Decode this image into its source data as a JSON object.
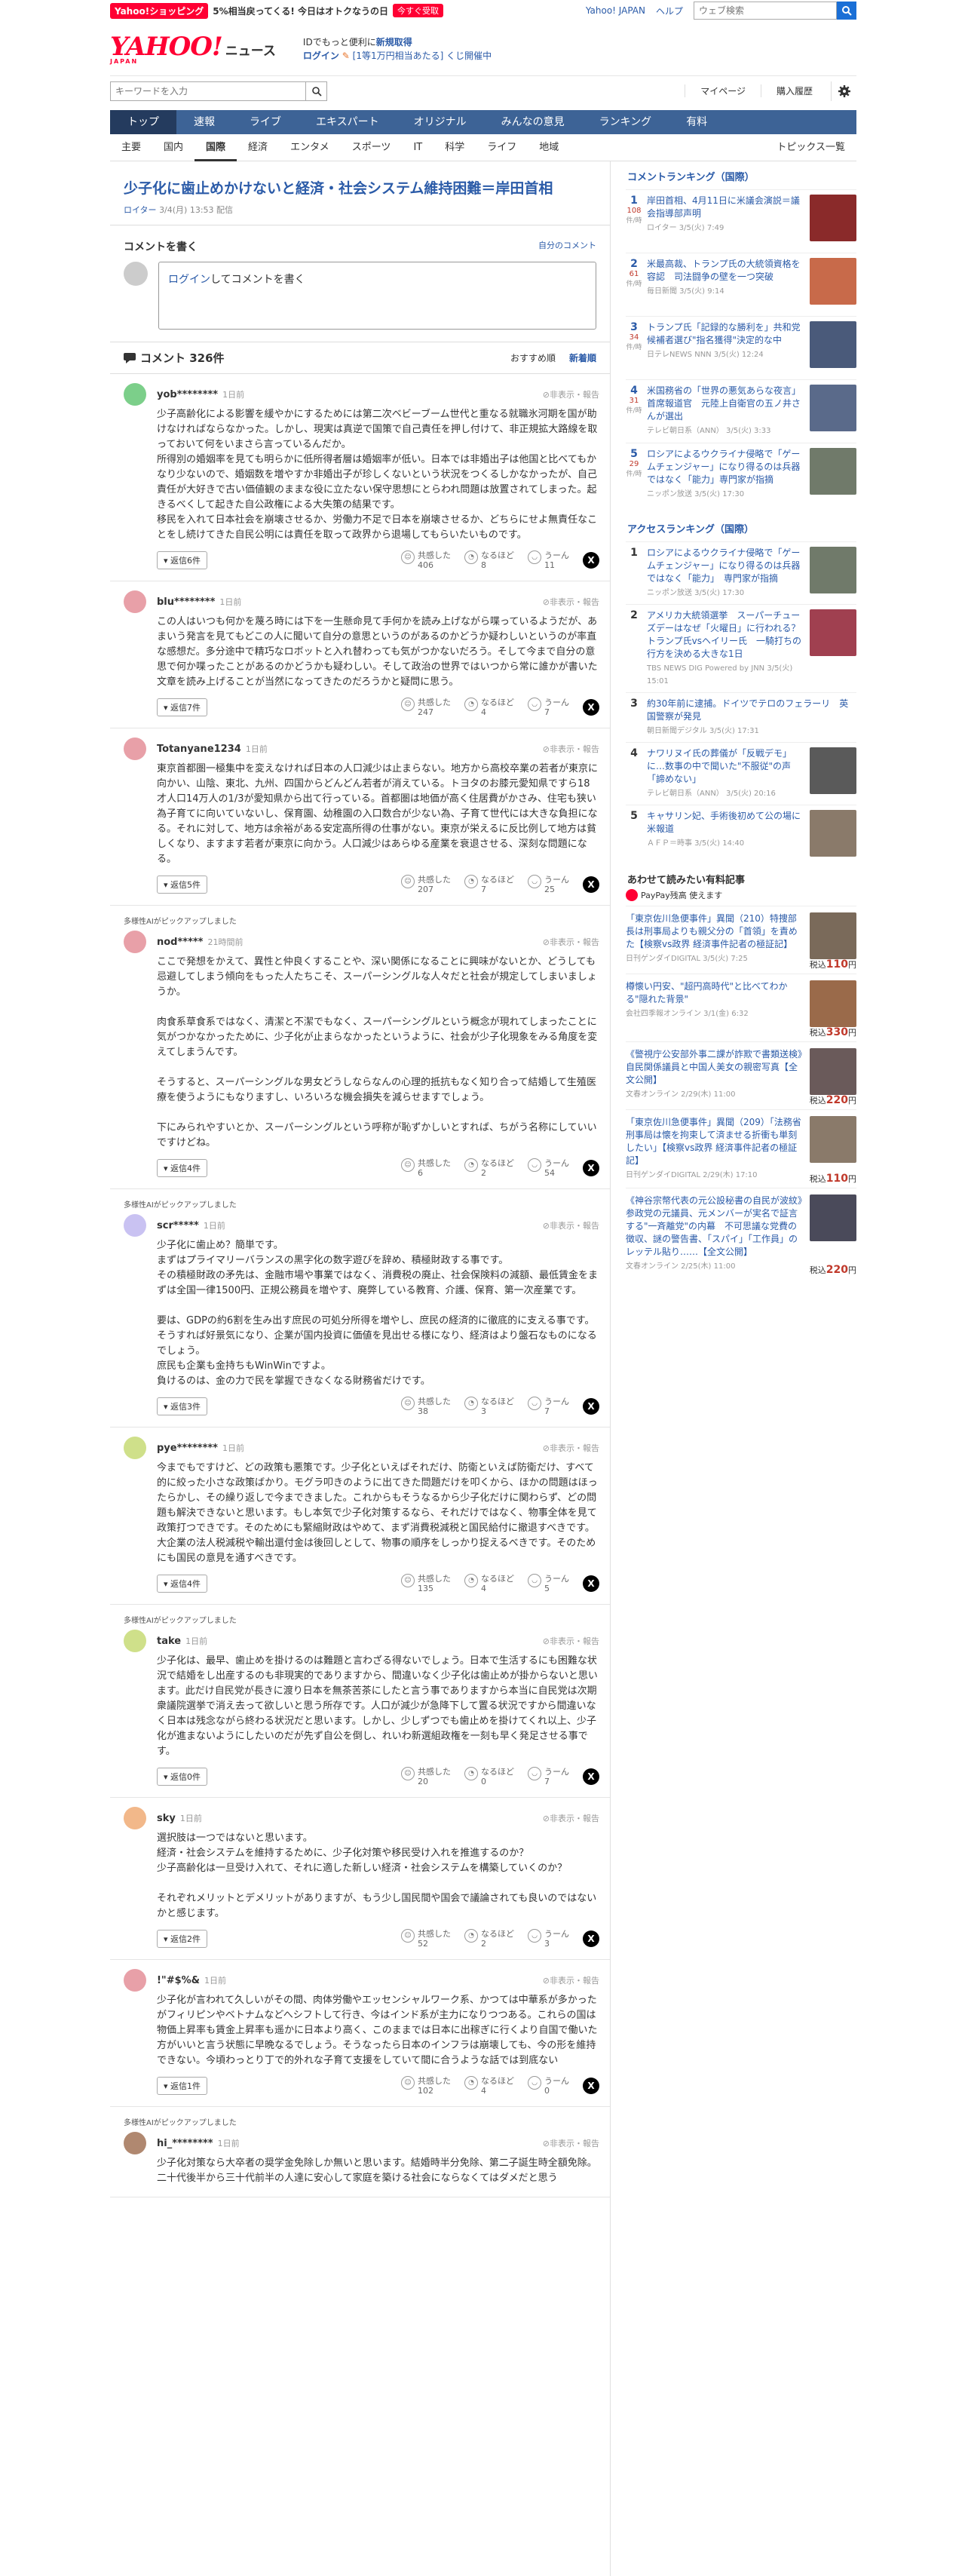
{
  "promo": {
    "shop": "Yahoo!ショッピング",
    "text": "5%相当戻ってくる! 今日はオトクなうの日",
    "button": "今すぐ受取"
  },
  "top_links": {
    "yahoo_japan": "Yahoo! JAPAN",
    "help": "ヘルプ",
    "search_placeholder": "ウェブ検索"
  },
  "logo": {
    "brand": "YAHOO!",
    "sub": "JAPAN",
    "news": "ニュース"
  },
  "header_msgs": {
    "line1_pre": "IDでもっと便利に",
    "line1_link": "新規取得",
    "line2_link": "ログイン",
    "line2_post": "[1等1万円相当あたる] くじ開催中"
  },
  "search": {
    "placeholder": "キーワードを入力"
  },
  "right_links": [
    "マイページ",
    "購入履歴"
  ],
  "main_nav": [
    {
      "label": "トップ",
      "active": true
    },
    {
      "label": "速報"
    },
    {
      "label": "ライブ"
    },
    {
      "label": "エキスパート"
    },
    {
      "label": "オリジナル"
    },
    {
      "label": "みんなの意見"
    },
    {
      "label": "ランキング"
    },
    {
      "label": "有料"
    }
  ],
  "sub_nav": [
    {
      "label": "主要"
    },
    {
      "label": "国内"
    },
    {
      "label": "国際",
      "active": true
    },
    {
      "label": "経済"
    },
    {
      "label": "エンタメ"
    },
    {
      "label": "スポーツ"
    },
    {
      "label": "IT"
    },
    {
      "label": "科学"
    },
    {
      "label": "ライフ"
    },
    {
      "label": "地域"
    }
  ],
  "topics": "トピックス一覧",
  "article": {
    "title": "少子化に歯止めかけないと経済・社会システム維持困難＝岸田首相",
    "source": "ロイター",
    "date": "3/4(月) 13:53 配信"
  },
  "comment_write": {
    "heading": "コメントを書く",
    "link": "自分のコメント",
    "login": "ログイン",
    "prompt": "してコメントを書く"
  },
  "comment_list": {
    "count": "コメント 326件",
    "sort_recommended": "おすすめ順",
    "sort_newest": "新着順"
  },
  "report_label": "非表示・報告",
  "react_labels": {
    "empathy": "共感した",
    "naruhodo": "なるほど",
    "uun": "うーん"
  },
  "comments": [
    {
      "user": "yob********",
      "time": "1日前",
      "color": "#7ccf8a",
      "pickup": "",
      "body": "少子高齢化による影響を緩やかにするためには第二次ベビーブーム世代と重なる就職氷河期を国が助けなければならなかった。しかし、現実は真逆で国策で自己責任を押し付けて、非正規拡大路線を取っておいて何をいまさら言っているんだか。\n所得別の婚姻率を見ても明らかに低所得者層は婚姻率が低い。日本では非婚出子は他国と比べてもかなり少ないので、婚姻数を増やすか非婚出子が珍しくないという状況をつくるしかなかったが、自己責任が大好きで古い価値観のままな役に立たない保守思想にとらわれ問題は放置されてしまった。起きるべくして起きた自公政権による大失策の結果です。\n移民を入れて日本社会を崩壊させるか、労働力不足で日本を崩壊させるか、どちらにせよ無責任なことをし続けてきた自民公明には責任を取って政界から退場してもらいたいものです。",
      "replies": "返信6件",
      "empathy": 406,
      "naruhodo": 8,
      "uun": 11
    },
    {
      "user": "blu********",
      "time": "1日前",
      "color": "#e8a0a8",
      "pickup": "",
      "body": "この人はいつも何かを蔑ろ時には下を一生懸命見て手何かを読み上げながら喋っているようだが、あまいう発言を見てもどこの人に聞いて自分の意思というのがあるのかどうか疑わしいというのが率直な感想だ。多分途中で精巧なロボットと入れ替わっても気がつかないだろう。そして今まで自分の意思で何か喋ったことがあるのかどうかも疑わしい。そして政治の世界ではいつから常に誰かが書いた文章を読み上げることが当然になってきたのだろうかと疑問に思う。",
      "replies": "返信7件",
      "empathy": 247,
      "naruhodo": 4,
      "uun": 7
    },
    {
      "user": "Totanyane1234",
      "time": "1日前",
      "color": "#e8a0a8",
      "pickup": "",
      "body": "東京首都圏一極集中を変えなければ日本の人口減少は止まらない。地方から高校卒業の若者が東京に向かい、山陰、東北、九州、四国からどんどん若者が消えている。トヨタのお膝元愛知県ですら18才人口14万人の1/3が愛知県から出て行っている。首都圏は地価が高く住居費がかさみ、住宅も狭い為子育てに向いていないし、保育園、幼稚園の入口数合が少ない為、子育て世代には大きな負担になる。それに対して、地方は余裕がある安定高所得の仕事がない。東京が栄えるに反比例して地方は貧しくなり、ますます若者が東京に向かう。人口減少はあらゆる産業を衰退させる、深刻な問題になる。",
      "replies": "返信5件",
      "empathy": 207,
      "naruhodo": 7,
      "uun": 25
    },
    {
      "user": "nod*****",
      "time": "21時間前",
      "color": "#e8a0a8",
      "pickup": "多様性AIがピックアップしました",
      "body": "ここで発想をかえて、異性と仲良くすることや、深い関係になることに興味がないとか、どうしても忌避してしまう傾向をもった人たちこそ、スーパーシングルな人々だと社会が規定してしまいましょうか。\n\n肉食系草食系ではなく、清潔と不潔でもなく、スーパーシングルという概念が現れてしまったことに気がつかなかったために、少子化が止まらなかったというように、社会が少子化現象をみる角度を変えてしまうんです。\n\nそうすると、スーパーシングルな男女どうしならなんの心理的抵抗もなく知り合って結婚して生殖医療を使うようにもなりますし、いろいろな機会損失を減らせますでしょう。\n\n下にみられやすいとか、スーパーシングルという呼称が恥ずかしいとすれば、ちがう名称にしていいですけどね。",
      "replies": "返信4件",
      "empathy": 6,
      "naruhodo": 2,
      "uun": 54
    },
    {
      "user": "scr*****",
      "time": "1日前",
      "color": "#c9c2f2",
      "pickup": "多様性AIがピックアップしました",
      "body": "少子化に歯止め？簡単です。\nまずはプライマリーバランスの黒字化の数字遊びを辞め、積極財政する事です。\nその積極財政の矛先は、金融市場や事業ではなく、消費税の廃止、社会保険料の減額、最低賃金をまずは全国一律1500円、正規公務員を増やす、廃弊している教育、介護、保育、第一次産業です。\n\n要は、GDPの約6割を生み出す庶民の可処分所得を増やし、庶民の経済的に徹底的に支える事です。\nそうすれば好景気になり、企業が国内投資に価値を見出せる様になり、経済はより盤石なものになるでしょう。\n庶民も企業も金持ちもWinWinですよ。\n負けるのは、金の力で民を掌握できなくなる財務省だけです。",
      "replies": "返信3件",
      "empathy": 38,
      "naruhodo": 3,
      "uun": 7
    },
    {
      "user": "pye********",
      "time": "1日前",
      "color": "#cfe08a",
      "pickup": "",
      "body": "今までもですけど、どの政策も悪策です。少子化といえばそれだけ、防衛といえば防衛だけ、すべて的に絞った小さな政策ばかり。モグラ叩きのように出てきた問題だけを叩くから、ほかの問題はほったらかし、その繰り返しで今まできました。これからもそうなるから少子化だけに関わらず、どの問題も解決できないと思います。もし本気で少子化対策するなら、それだけではなく、物事全体を見て政策打つできです。そのためにも緊縮財政はやめて、まず消費税減税と国民給付に撤退すべきです。大企業の法人税減税や輸出還付金は後回しとして、物事の順序をしっかり捉えるべきです。そのためにも国民の意見を通すべきです。",
      "replies": "返信4件",
      "empathy": 135,
      "naruhodo": 4,
      "uun": 5
    },
    {
      "user": "take",
      "time": "1日前",
      "color": "#cfe08a",
      "pickup": "多様性AIがピックアップしました",
      "body": "少子化は、最早、歯止めを掛けるのは難題と言わざる得ないでしょう。日本で生活するにも困難な状況で結婚をし出産するのも非現実的でありますから、間違いなく少子化は歯止めが掛からないと思います。此だけ自民党が長きに渡り日本を無茶苦茶にしたと言う事でありますから本当に自民党は次期衆議院選挙で消え去って欲しいと思う所存です。人口が減少が急降下して置る状況ですから間違いなく日本は残念ながら終わる状況だと思います。しかし、少しずつでも歯止めを掛けてくれ以上、少子化が進まないようにしたいのだが先ず自公を倒し、れいわ新選組政権を一刻も早く発足させる事です。",
      "replies": "返信0件",
      "empathy": 20,
      "naruhodo": 0,
      "uun": 7
    },
    {
      "user": "sky",
      "time": "1日前",
      "color": "#f2b88a",
      "pickup": "",
      "body": "選択肢は一つではないと思います。\n経済・社会システムを維持するために、少子化対策や移民受け入れを推進するのか？\n少子高齢化は一旦受け入れて、それに適した新しい経済・社会システムを構築していくのか？\n\nそれぞれメリットとデメリットがありますが、もう少し国民間や国会で議論されても良いのではないかと感じます。",
      "replies": "返信2件",
      "empathy": 52,
      "naruhodo": 2,
      "uun": 3
    },
    {
      "user": "!\"#$%&",
      "time": "1日前",
      "color": "#e8a0a8",
      "pickup": "",
      "body": "少子化が言われて久しいがその間、肉体労働やエッセンシャルワーク系、かつては中華系が多かったがフィリピンやベトナムなどへシフトして行き、今はインド系が主力になりつつある。これらの国は物価上昇率も賃金上昇率も遥かに日本より高く、このままでは日本に出稼ぎに行くより自国で働いた方がいいと言う状態に早晩なるでしょう。そうなったら日本のインフラは崩壊しても、今の形を維持できない。今頃わっとり丁で的外れな子育て支援をしていて間に合うような話では到底ない",
      "replies": "返信1件",
      "empathy": 102,
      "naruhodo": 4,
      "uun": 0
    },
    {
      "user": "hi_********",
      "time": "1日前",
      "color": "#b08870",
      "pickup": "多様性AIがピックアップしました",
      "body": "少子化対策なら大卒者の奨学金免除しか無いと思います。結婚時半分免除、第二子誕生時全額免除。二十代後半から三十代前半の人達に安心して家庭を築ける社会にならなくてはダメだと思う",
      "replies": "",
      "empathy": null,
      "naruhodo": null,
      "uun": null
    }
  ],
  "side": {
    "comment_ranking_title": "コメントランキング（国際）",
    "comment_ranking": [
      {
        "rank": "1",
        "count": "108",
        "unit": "件/時",
        "title": "岸田首相、4月11日に米議会演説＝議会指導部声明",
        "src": "ロイター 3/5(火) 7:49",
        "thumb": "#8a2a2a"
      },
      {
        "rank": "2",
        "count": "61",
        "unit": "件/時",
        "title": "米最高裁、トランプ氏の大統領資格を容認　司法闘争の壁を一つ突破",
        "src": "毎日新聞 3/5(火) 9:14",
        "thumb": "#c86a4a"
      },
      {
        "rank": "3",
        "count": "34",
        "unit": "件/時",
        "title": "トランプ氏「記録的な勝利を」共和党候補者選び\"指名獲得\"決定的な中",
        "src": "日テレNEWS NNN 3/5(火) 12:24",
        "thumb": "#4a5a7a"
      },
      {
        "rank": "4",
        "count": "31",
        "unit": "件/時",
        "title": "米国務省の「世界の悪気あらな夜言」首席報道官　元陸上自衛官の五ノ井さんが選出",
        "src": "テレビ朝日系（ANN） 3/5(火) 3:33",
        "thumb": "#5a6a8a"
      },
      {
        "rank": "5",
        "count": "29",
        "unit": "件/時",
        "title": "ロシアによるウクライナ侵略で「ゲームチェンジャー」になり得るのは兵器ではなく「能力」専門家が指摘",
        "src": "ニッポン放送 3/5(火) 17:30",
        "thumb": "#707a6a"
      }
    ],
    "access_ranking_title": "アクセスランキング（国際）",
    "access_ranking": [
      {
        "rank": "1",
        "title": "ロシアによるウクライナ侵略で「ゲームチェンジャー」になり得るのは兵器ではなく「能力」　専門家が指摘",
        "src": "ニッポン放送 3/5(火) 17:30",
        "thumb": "#707a6a"
      },
      {
        "rank": "2",
        "title": "アメリカ大統領選挙　スーパーチューズデーはなぜ「火曜日」に行われる？トランプ氏vsヘイリー氏　一騎打ちの行方を決める大きな1日",
        "src": "TBS NEWS DIG Powered by JNN 3/5(火) 15:01",
        "thumb": "#a04050"
      },
      {
        "rank": "3",
        "title": "約30年前に逮捕。ドイツでテロのフェラーリ　英国警察が発見",
        "src": "朝日新聞デジタル 3/5(火) 17:31",
        "thumb": ""
      },
      {
        "rank": "4",
        "title": "ナワリヌイ氏の葬儀が「反戦デモ」に…数事の中で聞いた\"不服従\"の声「諦めない」",
        "src": "テレビ朝日系（ANN） 3/5(火) 20:16",
        "thumb": "#5a5a5a"
      },
      {
        "rank": "5",
        "title": "キャサリン妃、手術後初めて公の場に 米報道",
        "src": "ＡＦＰ＝時事 3/5(火) 14:40",
        "thumb": "#8a7a6a"
      }
    ],
    "ads_title": "あわせて読みたい有料記事",
    "paypay": "PayPay残高 使えます",
    "ads": [
      {
        "title": "「東京佐川急便事件」異聞（210）特捜部長は刑事局よりも親父分の「首領」を責めた【検察vs政界 経済事件記者の極証記】",
        "src": "日刊ゲンダイDIGITAL 3/5(火) 7:25",
        "price": "110",
        "unit": "円",
        "prefix": "税込",
        "thumb": "#7a6a5a"
      },
      {
        "title": "樽懐い円安、\"超円高時代\"と比べてわかる\"隠れた背景\"",
        "src": "会社四季報オンライン 3/1(金) 6:32",
        "price": "330",
        "unit": "円",
        "prefix": "税込",
        "thumb": "#9a6a4a"
      },
      {
        "title": "《警視庁公安部外事二課が詐欺で書類送検》自民関係議員と中国人美女の親密写真【全文公開】",
        "src": "文春オンライン 2/29(木) 11:00",
        "price": "220",
        "unit": "円",
        "prefix": "税込",
        "thumb": "#6a5a5a"
      },
      {
        "title": "「東京佐川急便事件」異聞（209）「法務省刑事局は懐を拘束して済ませる折衝も単刻したい」【検察vs政界 経済事件記者の極証記】",
        "src": "日刊ゲンダイDIGITAL 2/29(木) 17:10",
        "price": "110",
        "unit": "円",
        "prefix": "税込",
        "thumb": "#8a7a6a"
      },
      {
        "title": "《神谷宗幣代表の元公設秘書の自民が波紋》参政党の元議員、元メンバーが実名で証言する\"一斉離党\"の内幕　不可思議な党費の徴収、謎の警告書、「スパイ」「工作員」のレッテル貼り……【全文公開】",
        "src": "文春オンライン 2/25(木) 11:00",
        "price": "220",
        "unit": "円",
        "prefix": "税込",
        "thumb": "#4a4a5a"
      }
    ]
  }
}
